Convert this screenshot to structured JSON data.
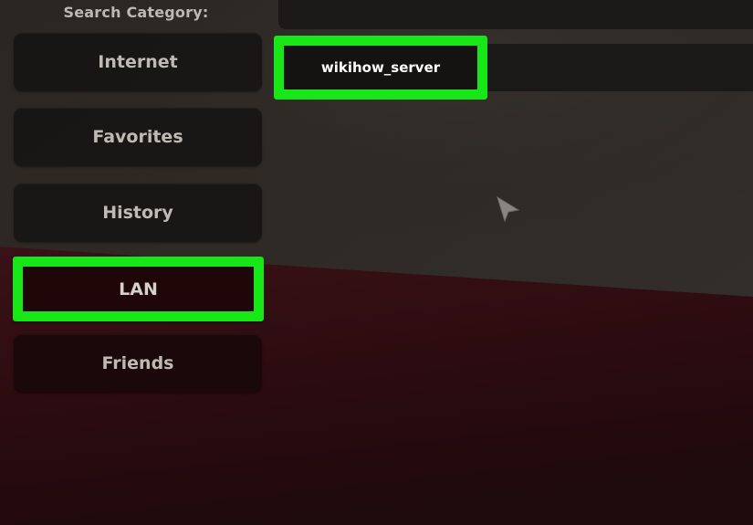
{
  "sidebar": {
    "heading": "Search Category:",
    "items": [
      {
        "label": "Internet"
      },
      {
        "label": "Favorites"
      },
      {
        "label": "History"
      },
      {
        "label": "LAN",
        "selected": true
      },
      {
        "label": "Friends"
      }
    ]
  },
  "server_list": {
    "servers": [
      {
        "name": "wikihow_server"
      }
    ]
  },
  "colors": {
    "highlight": "#17e617",
    "text": "#bfbab4",
    "panel": "#1b1918"
  }
}
